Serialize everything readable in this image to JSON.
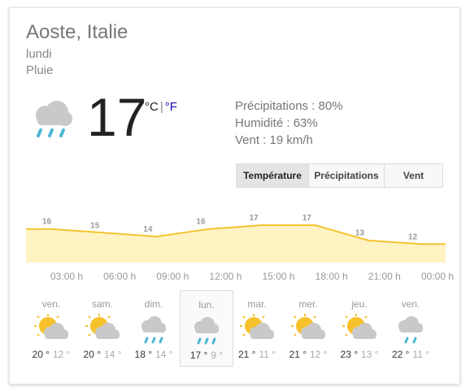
{
  "location": "Aoste, Italie",
  "current": {
    "day": "lundi",
    "condition": "Pluie",
    "icon": "rain-cloud-icon",
    "temp": "17",
    "unit_c": "°C",
    "unit_sep": "|",
    "unit_f": "°F"
  },
  "details": {
    "precip": "Précipitations : 80%",
    "humidity": "Humidité : 63%",
    "wind": "Vent : 19 km/h"
  },
  "tabs": [
    "Température",
    "Précipitations",
    "Vent"
  ],
  "active_tab": "Température",
  "chart_data": {
    "type": "area",
    "x": [
      "03:00 h",
      "06:00 h",
      "09:00 h",
      "12:00 h",
      "15:00 h",
      "18:00 h",
      "21:00 h",
      "00:00 h"
    ],
    "values": [
      16,
      15,
      14,
      16,
      17,
      17,
      13,
      12
    ],
    "ylim": [
      8,
      20
    ],
    "grid": false
  },
  "forecast": [
    {
      "day": "ven.",
      "hi": "20 °",
      "lo": "12 °",
      "icon": "sun-cloud-icon",
      "selected": false
    },
    {
      "day": "sam.",
      "hi": "20 °",
      "lo": "14 °",
      "icon": "sun-cloud-icon",
      "selected": false
    },
    {
      "day": "dim.",
      "hi": "18 °",
      "lo": "14 °",
      "icon": "rain-cloud-icon",
      "selected": false
    },
    {
      "day": "lun.",
      "hi": "17 °",
      "lo": "9 °",
      "icon": "rain-cloud-icon",
      "selected": true
    },
    {
      "day": "mar.",
      "hi": "21 °",
      "lo": "11 °",
      "icon": "sun-cloud-icon",
      "selected": false
    },
    {
      "day": "mer.",
      "hi": "21 °",
      "lo": "12 °",
      "icon": "sun-cloud-icon",
      "selected": false
    },
    {
      "day": "jeu.",
      "hi": "23 °",
      "lo": "13 °",
      "icon": "sun-cloud-icon",
      "selected": false
    },
    {
      "day": "ven.",
      "hi": "22 °",
      "lo": "11 °",
      "icon": "light-rain-cloud-icon",
      "selected": false
    }
  ],
  "colors": {
    "line": "#f4c430",
    "area": "#fff3c4",
    "rain": "#4db6d3",
    "sun": "#f6c12b",
    "cloud": "#c9c9c9"
  }
}
